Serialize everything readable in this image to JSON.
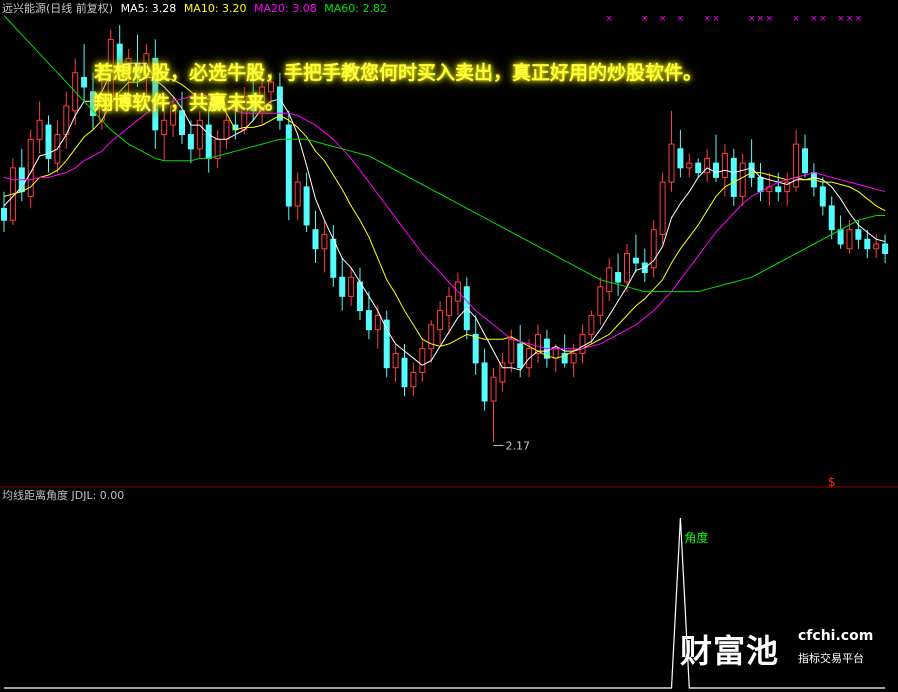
{
  "legend": {
    "title": "远兴能源(日线 前复权)",
    "ma5": "MA5: 3.28",
    "ma10": "MA10: 3.20",
    "ma20": "MA20: 3.08",
    "ma60": "MA60: 2.82"
  },
  "sub_legend": {
    "title": "均线距离角度",
    "value": "JDJL: 0.00"
  },
  "promo": {
    "line1": "若想炒股，必选牛股，手把手教您何时买入卖出，真正好用的炒股软件。",
    "line2": "翔博软件，共赢未来。"
  },
  "watermark": {
    "logo": "财富池",
    "domain": "cfchi.com",
    "tagline": "指标交易平台"
  },
  "colors": {
    "up": "#ff3c3c",
    "down": "#54fcfc",
    "ma5": "#ffffff",
    "ma10": "#ffff00",
    "ma20": "#ff00ff",
    "ma60": "#00e000",
    "marker": "#ff00ff",
    "sub_line": "#ffffff",
    "sub_label": "#00ff00",
    "grid": "#8b0000"
  },
  "chart_data": [
    {
      "type": "candlestick",
      "ylim": [
        2.05,
        3.95
      ],
      "low_marker": "2.17",
      "top_markers": [
        "×",
        "×",
        "×",
        "×",
        "×",
        "×",
        "×",
        "×",
        "×",
        "×",
        "×",
        "×",
        "×",
        "×",
        "×"
      ],
      "signal_marker": "$",
      "ohlc": [
        [
          3.15,
          3.22,
          3.05,
          3.1
        ],
        [
          3.1,
          3.36,
          3.08,
          3.32
        ],
        [
          3.32,
          3.4,
          3.18,
          3.22
        ],
        [
          3.2,
          3.48,
          3.15,
          3.44
        ],
        [
          3.44,
          3.6,
          3.38,
          3.52
        ],
        [
          3.5,
          3.54,
          3.3,
          3.36
        ],
        [
          3.34,
          3.52,
          3.3,
          3.46
        ],
        [
          3.46,
          3.64,
          3.4,
          3.58
        ],
        [
          3.56,
          3.78,
          3.5,
          3.72
        ],
        [
          3.7,
          3.84,
          3.6,
          3.66
        ],
        [
          3.64,
          3.72,
          3.48,
          3.54
        ],
        [
          3.52,
          3.7,
          3.48,
          3.62
        ],
        [
          3.62,
          3.9,
          3.58,
          3.86
        ],
        [
          3.84,
          3.92,
          3.7,
          3.74
        ],
        [
          3.72,
          3.82,
          3.6,
          3.78
        ],
        [
          3.76,
          3.88,
          3.66,
          3.7
        ],
        [
          3.7,
          3.84,
          3.62,
          3.8
        ],
        [
          3.78,
          3.86,
          3.4,
          3.48
        ],
        [
          3.46,
          3.56,
          3.35,
          3.52
        ],
        [
          3.5,
          3.62,
          3.45,
          3.58
        ],
        [
          3.56,
          3.64,
          3.42,
          3.46
        ],
        [
          3.46,
          3.52,
          3.34,
          3.4
        ],
        [
          3.4,
          3.56,
          3.36,
          3.52
        ],
        [
          3.5,
          3.58,
          3.3,
          3.36
        ],
        [
          3.36,
          3.48,
          3.32,
          3.44
        ],
        [
          3.44,
          3.56,
          3.4,
          3.52
        ],
        [
          3.5,
          3.6,
          3.44,
          3.48
        ],
        [
          3.48,
          3.66,
          3.46,
          3.62
        ],
        [
          3.6,
          3.7,
          3.52,
          3.56
        ],
        [
          3.56,
          3.7,
          3.5,
          3.66
        ],
        [
          3.64,
          3.72,
          3.58,
          3.68
        ],
        [
          3.66,
          3.72,
          3.48,
          3.52
        ],
        [
          3.5,
          3.56,
          3.1,
          3.16
        ],
        [
          3.16,
          3.3,
          3.1,
          3.26
        ],
        [
          3.24,
          3.3,
          3.05,
          3.08
        ],
        [
          3.06,
          3.14,
          2.92,
          2.98
        ],
        [
          2.98,
          3.1,
          2.88,
          3.04
        ],
        [
          3.02,
          3.08,
          2.82,
          2.86
        ],
        [
          2.86,
          2.94,
          2.72,
          2.78
        ],
        [
          2.78,
          2.9,
          2.74,
          2.86
        ],
        [
          2.84,
          2.9,
          2.68,
          2.72
        ],
        [
          2.72,
          2.8,
          2.6,
          2.64
        ],
        [
          2.64,
          2.74,
          2.56,
          2.7
        ],
        [
          2.68,
          2.72,
          2.44,
          2.48
        ],
        [
          2.48,
          2.58,
          2.42,
          2.54
        ],
        [
          2.52,
          2.58,
          2.36,
          2.4
        ],
        [
          2.4,
          2.5,
          2.36,
          2.46
        ],
        [
          2.46,
          2.6,
          2.42,
          2.56
        ],
        [
          2.56,
          2.68,
          2.5,
          2.66
        ],
        [
          2.64,
          2.76,
          2.58,
          2.72
        ],
        [
          2.7,
          2.82,
          2.62,
          2.78
        ],
        [
          2.76,
          2.88,
          2.7,
          2.84
        ],
        [
          2.82,
          2.86,
          2.6,
          2.64
        ],
        [
          2.62,
          2.7,
          2.45,
          2.5
        ],
        [
          2.5,
          2.56,
          2.3,
          2.34
        ],
        [
          2.34,
          2.48,
          2.17,
          2.44
        ],
        [
          2.42,
          2.54,
          2.38,
          2.5
        ],
        [
          2.5,
          2.64,
          2.46,
          2.6
        ],
        [
          2.58,
          2.66,
          2.44,
          2.48
        ],
        [
          2.48,
          2.6,
          2.44,
          2.56
        ],
        [
          2.54,
          2.66,
          2.5,
          2.62
        ],
        [
          2.6,
          2.64,
          2.48,
          2.52
        ],
        [
          2.52,
          2.58,
          2.46,
          2.56
        ],
        [
          2.54,
          2.62,
          2.48,
          2.5
        ],
        [
          2.5,
          2.58,
          2.44,
          2.54
        ],
        [
          2.54,
          2.66,
          2.5,
          2.62
        ],
        [
          2.62,
          2.72,
          2.58,
          2.7
        ],
        [
          2.7,
          2.86,
          2.66,
          2.82
        ],
        [
          2.8,
          2.94,
          2.76,
          2.9
        ],
        [
          2.88,
          2.96,
          2.78,
          2.84
        ],
        [
          2.84,
          3.0,
          2.8,
          2.96
        ],
        [
          2.94,
          3.04,
          2.88,
          2.92
        ],
        [
          2.92,
          2.98,
          2.84,
          2.88
        ],
        [
          2.9,
          3.1,
          2.86,
          3.06
        ],
        [
          3.04,
          3.3,
          3.0,
          3.26
        ],
        [
          3.26,
          3.56,
          3.22,
          3.42
        ],
        [
          3.4,
          3.48,
          3.28,
          3.32
        ],
        [
          3.32,
          3.38,
          3.28,
          3.34
        ],
        [
          3.34,
          3.36,
          3.28,
          3.3
        ],
        [
          3.3,
          3.4,
          3.26,
          3.36
        ],
        [
          3.34,
          3.46,
          3.26,
          3.28
        ],
        [
          3.28,
          3.42,
          3.2,
          3.38
        ],
        [
          3.36,
          3.4,
          3.16,
          3.2
        ],
        [
          3.2,
          3.38,
          3.16,
          3.34
        ],
        [
          3.34,
          3.44,
          3.24,
          3.28
        ],
        [
          3.28,
          3.34,
          3.18,
          3.22
        ],
        [
          3.22,
          3.3,
          3.16,
          3.24
        ],
        [
          3.24,
          3.3,
          3.18,
          3.22
        ],
        [
          3.22,
          3.3,
          3.16,
          3.26
        ],
        [
          3.24,
          3.48,
          3.22,
          3.42
        ],
        [
          3.4,
          3.46,
          3.28,
          3.3
        ],
        [
          3.3,
          3.34,
          3.2,
          3.24
        ],
        [
          3.24,
          3.28,
          3.12,
          3.16
        ],
        [
          3.16,
          3.2,
          3.02,
          3.06
        ],
        [
          3.06,
          3.12,
          2.98,
          3.0
        ],
        [
          2.98,
          3.1,
          2.96,
          3.06
        ],
        [
          3.06,
          3.1,
          2.98,
          3.02
        ],
        [
          3.02,
          3.06,
          2.94,
          2.98
        ],
        [
          2.98,
          3.04,
          2.94,
          3.0
        ],
        [
          3.0,
          3.04,
          2.92,
          2.96
        ]
      ],
      "series": [
        {
          "name": "MA5",
          "values": [
            3.16,
            3.2,
            3.24,
            3.3,
            3.37,
            3.38,
            3.4,
            3.46,
            3.54,
            3.6,
            3.6,
            3.64,
            3.72,
            3.75,
            3.76,
            3.76,
            3.76,
            3.69,
            3.66,
            3.62,
            3.57,
            3.5,
            3.5,
            3.46,
            3.44,
            3.44,
            3.46,
            3.48,
            3.52,
            3.57,
            3.6,
            3.61,
            3.55,
            3.46,
            3.33,
            3.19,
            3.1,
            3.02,
            2.94,
            2.9,
            2.84,
            2.78,
            2.72,
            2.64,
            2.58,
            2.55,
            2.52,
            2.49,
            2.51,
            2.57,
            2.63,
            2.69,
            2.73,
            2.69,
            2.62,
            2.55,
            2.48,
            2.48,
            2.47,
            2.52,
            2.55,
            2.55,
            2.57,
            2.55,
            2.55,
            2.57,
            2.59,
            2.64,
            2.7,
            2.76,
            2.82,
            2.89,
            2.9,
            2.93,
            2.99,
            3.11,
            3.17,
            3.22,
            3.28,
            3.32,
            3.3,
            3.31,
            3.3,
            3.31,
            3.32,
            3.28,
            3.27,
            3.26,
            3.25,
            3.27,
            3.27,
            3.28,
            3.27,
            3.24,
            3.19,
            3.13,
            3.08,
            3.05,
            3.02,
            3.01
          ]
        },
        {
          "name": "MA10",
          "values": [
            3.2,
            3.21,
            3.22,
            3.24,
            3.28,
            3.29,
            3.31,
            3.35,
            3.4,
            3.45,
            3.48,
            3.52,
            3.59,
            3.64,
            3.68,
            3.68,
            3.7,
            3.7,
            3.7,
            3.69,
            3.67,
            3.64,
            3.61,
            3.61,
            3.6,
            3.55,
            3.48,
            3.49,
            3.49,
            3.5,
            3.52,
            3.54,
            3.52,
            3.49,
            3.45,
            3.39,
            3.35,
            3.29,
            3.23,
            3.16,
            3.1,
            3.03,
            2.94,
            2.85,
            2.79,
            2.72,
            2.66,
            2.6,
            2.58,
            2.57,
            2.58,
            2.6,
            2.62,
            2.61,
            2.6,
            2.6,
            2.6,
            2.61,
            2.59,
            2.57,
            2.55,
            2.53,
            2.52,
            2.53,
            2.55,
            2.56,
            2.58,
            2.6,
            2.62,
            2.66,
            2.7,
            2.74,
            2.77,
            2.81,
            2.85,
            2.92,
            2.98,
            3.03,
            3.08,
            3.14,
            3.2,
            3.24,
            3.26,
            3.28,
            3.3,
            3.3,
            3.29,
            3.28,
            3.27,
            3.28,
            3.27,
            3.27,
            3.26,
            3.26,
            3.25,
            3.24,
            3.22,
            3.19,
            3.16,
            3.14
          ]
        },
        {
          "name": "MA20",
          "values": [
            3.28,
            3.27,
            3.27,
            3.27,
            3.28,
            3.28,
            3.29,
            3.3,
            3.32,
            3.35,
            3.37,
            3.39,
            3.43,
            3.46,
            3.49,
            3.52,
            3.55,
            3.57,
            3.59,
            3.6,
            3.61,
            3.62,
            3.63,
            3.62,
            3.6,
            3.58,
            3.56,
            3.55,
            3.55,
            3.55,
            3.55,
            3.55,
            3.55,
            3.54,
            3.52,
            3.5,
            3.47,
            3.44,
            3.4,
            3.36,
            3.31,
            3.26,
            3.21,
            3.16,
            3.11,
            3.06,
            3.01,
            2.96,
            2.92,
            2.88,
            2.84,
            2.8,
            2.76,
            2.72,
            2.69,
            2.66,
            2.63,
            2.6,
            2.59,
            2.58,
            2.57,
            2.56,
            2.56,
            2.56,
            2.56,
            2.56,
            2.57,
            2.58,
            2.6,
            2.62,
            2.64,
            2.66,
            2.69,
            2.72,
            2.76,
            2.8,
            2.85,
            2.9,
            2.95,
            3.0,
            3.05,
            3.09,
            3.13,
            3.17,
            3.2,
            3.22,
            3.24,
            3.26,
            3.27,
            3.28,
            3.29,
            3.3,
            3.29,
            3.28,
            3.27,
            3.26,
            3.25,
            3.24,
            3.23,
            3.22
          ]
        },
        {
          "name": "MA60",
          "values": [
            3.96,
            3.92,
            3.88,
            3.84,
            3.8,
            3.76,
            3.72,
            3.68,
            3.64,
            3.6,
            3.56,
            3.52,
            3.48,
            3.45,
            3.42,
            3.4,
            3.38,
            3.36,
            3.35,
            3.35,
            3.35,
            3.35,
            3.36,
            3.36,
            3.37,
            3.38,
            3.39,
            3.4,
            3.41,
            3.42,
            3.43,
            3.44,
            3.44,
            3.44,
            3.44,
            3.43,
            3.42,
            3.41,
            3.4,
            3.39,
            3.38,
            3.37,
            3.35,
            3.33,
            3.31,
            3.29,
            3.27,
            3.25,
            3.23,
            3.21,
            3.19,
            3.17,
            3.15,
            3.13,
            3.11,
            3.09,
            3.07,
            3.05,
            3.03,
            3.01,
            2.99,
            2.97,
            2.95,
            2.93,
            2.91,
            2.89,
            2.87,
            2.85,
            2.84,
            2.83,
            2.82,
            2.81,
            2.8,
            2.8,
            2.8,
            2.8,
            2.8,
            2.8,
            2.8,
            2.81,
            2.82,
            2.83,
            2.84,
            2.85,
            2.86,
            2.88,
            2.9,
            2.92,
            2.94,
            2.96,
            2.98,
            3.0,
            3.02,
            3.04,
            3.06,
            3.08,
            3.1,
            3.11,
            3.12,
            3.12
          ]
        }
      ]
    },
    {
      "type": "line",
      "name": "JDJL",
      "label": "角度",
      "ylim": [
        0,
        90
      ],
      "values": [
        0,
        0,
        0,
        0,
        0,
        0,
        0,
        0,
        0,
        0,
        0,
        0,
        0,
        0,
        0,
        0,
        0,
        0,
        0,
        0,
        0,
        0,
        0,
        0,
        0,
        0,
        0,
        0,
        0,
        0,
        0,
        0,
        0,
        0,
        0,
        0,
        0,
        0,
        0,
        0,
        0,
        0,
        0,
        0,
        0,
        0,
        0,
        0,
        0,
        0,
        0,
        0,
        0,
        0,
        0,
        0,
        0,
        0,
        0,
        0,
        0,
        0,
        0,
        0,
        0,
        0,
        0,
        0,
        0,
        0,
        0,
        0,
        0,
        0,
        0,
        0,
        85,
        0,
        0,
        0,
        0,
        0,
        0,
        0,
        0,
        0,
        0,
        0,
        0,
        0,
        0,
        0,
        0,
        0,
        0,
        0,
        0,
        0,
        0,
        0
      ]
    }
  ]
}
